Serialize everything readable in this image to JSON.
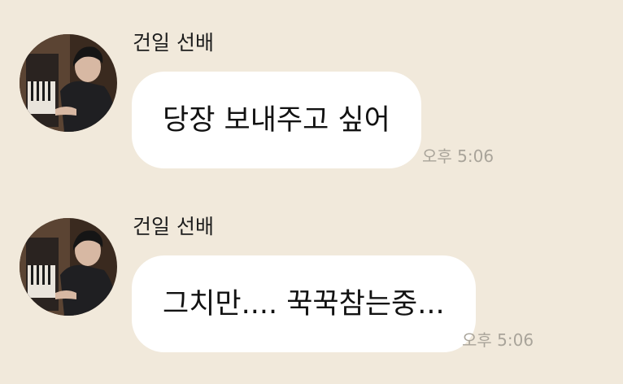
{
  "theme": {
    "background": "#F1E9DB",
    "bubble": "#FFFFFF",
    "timestamp_color": "#A9A49A"
  },
  "messages": [
    {
      "sender": "건일 선배",
      "avatar_icon": "profile-photo-person-at-piano",
      "text": "당장 보내주고 싶어",
      "time": "오후 5:06"
    },
    {
      "sender": "건일 선배",
      "avatar_icon": "profile-photo-person-at-piano",
      "text": "그치만.... 꾹꾹참는중...",
      "time": "오후 5:06"
    }
  ]
}
